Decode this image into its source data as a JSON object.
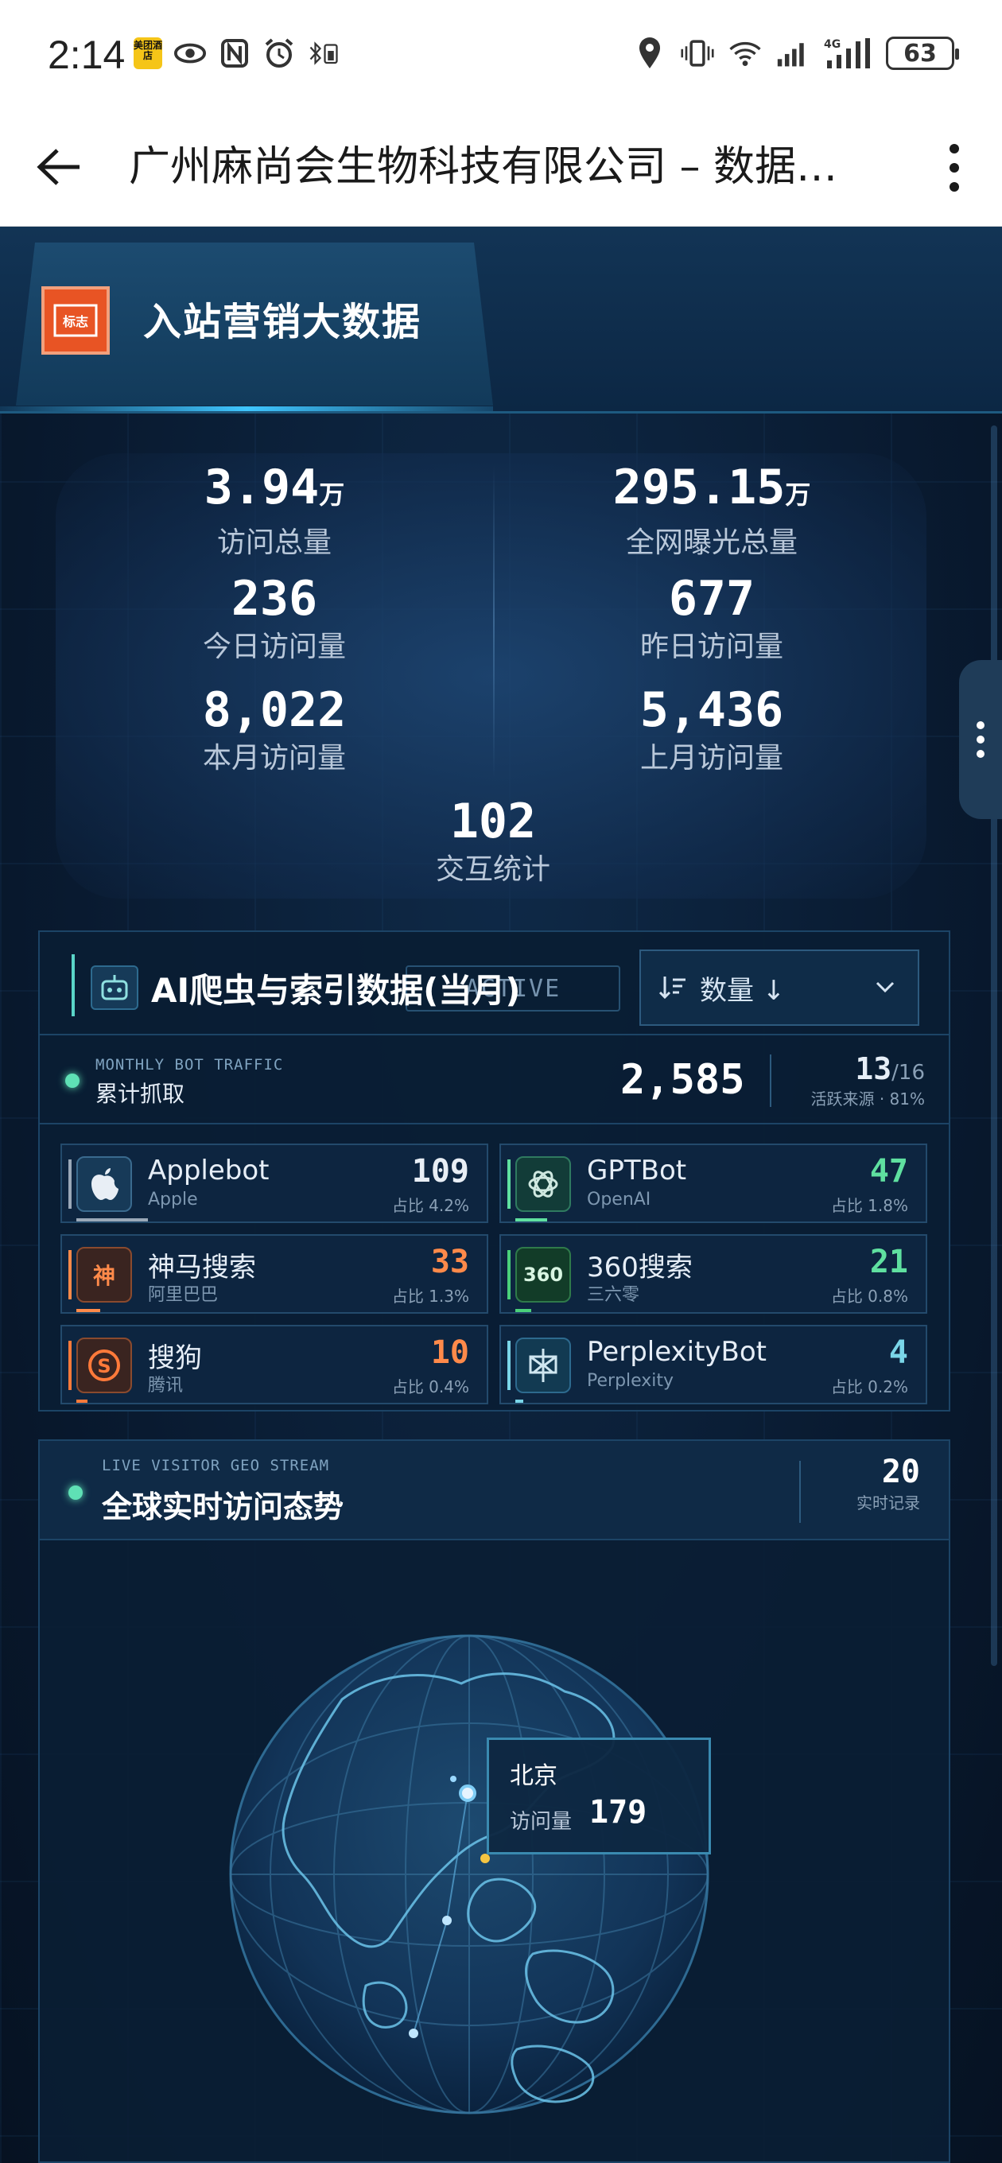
{
  "status_bar": {
    "time": "2:14",
    "app_badge": "美团酒店",
    "network": "4G",
    "battery": "63",
    "icons_left": [
      "meituan-app-icon",
      "eye-icon",
      "nfc-icon",
      "alarm-icon",
      "bluetooth-battery-icon"
    ],
    "icons_right": [
      "location-icon",
      "vibrate-icon",
      "wifi-icon",
      "signal-icon",
      "signal-4g-icon",
      "battery-icon"
    ]
  },
  "app_bar": {
    "title": "广州麻尚会生物科技有限公司 – 数据…"
  },
  "header": {
    "logo_text": "标志",
    "title": "入站营销大数据"
  },
  "stats": {
    "total_visits": {
      "value": "3.94",
      "unit": "万",
      "label": "访问总量"
    },
    "total_exposure": {
      "value": "295.15",
      "unit": "万",
      "label": "全网曝光总量"
    },
    "today": {
      "value": "236",
      "label": "今日访问量"
    },
    "yesterday": {
      "value": "677",
      "label": "昨日访问量"
    },
    "this_month": {
      "value": "8,022",
      "label": "本月访问量"
    },
    "last_month": {
      "value": "5,436",
      "label": "上月访问量"
    },
    "interactions": {
      "value": "102",
      "label": "交互统计"
    }
  },
  "bot_panel": {
    "title": "AI爬虫与索引数据(当月)",
    "badge": "ACTIVE",
    "sort_label": "数量 ↓",
    "summary_sub": "MONTHLY BOT TRAFFIC",
    "summary_label": "累计抓取",
    "total": "2,585",
    "active_count": "13",
    "active_of": "/16",
    "active_label": "活跃来源 · 81%",
    "bots": [
      {
        "name": "Applebot",
        "org": "Apple",
        "count": "109",
        "pct": "占比 4.2%",
        "color": "#e8eef5",
        "bar": "#9aa8b8",
        "icon": "apple-icon"
      },
      {
        "name": "GPTBot",
        "org": "OpenAI",
        "count": "47",
        "pct": "占比 1.8%",
        "color": "#5fe0a0",
        "bar": "#5fe0a0",
        "icon": "openai-icon"
      },
      {
        "name": "神马搜索",
        "org": "阿里巴巴",
        "count": "33",
        "pct": "占比 1.3%",
        "color": "#ff8a4a",
        "bar": "#ff8a4a",
        "icon_text": "神",
        "icon": "shenma-icon"
      },
      {
        "name": "360搜索",
        "org": "三六零",
        "count": "21",
        "pct": "占比 0.8%",
        "color": "#5fe0a0",
        "bar": "#4ad07a",
        "icon_text": "360",
        "icon": "360-search-icon"
      },
      {
        "name": "搜狗",
        "org": "腾讯",
        "count": "10",
        "pct": "占比 0.4%",
        "color": "#ff8a4a",
        "bar": "#ff7a3a",
        "icon_text": "S",
        "icon": "sogou-icon"
      },
      {
        "name": "PerplexityBot",
        "org": "Perplexity",
        "count": "4",
        "pct": "占比 0.2%",
        "color": "#7ad6e8",
        "bar": "#7ad6e8",
        "icon": "perplexity-icon"
      }
    ]
  },
  "geo_panel": {
    "sub": "LIVE VISITOR GEO STREAM",
    "title": "全球实时访问态势",
    "records": "20",
    "records_label": "实时记录",
    "tooltip": {
      "city": "北京",
      "label": "访问量",
      "value": "179"
    }
  },
  "colors": {
    "accent": "#3fc6ff",
    "green": "#5fe0b5",
    "orange": "#ff8a4a",
    "panel": "#0d2540"
  }
}
